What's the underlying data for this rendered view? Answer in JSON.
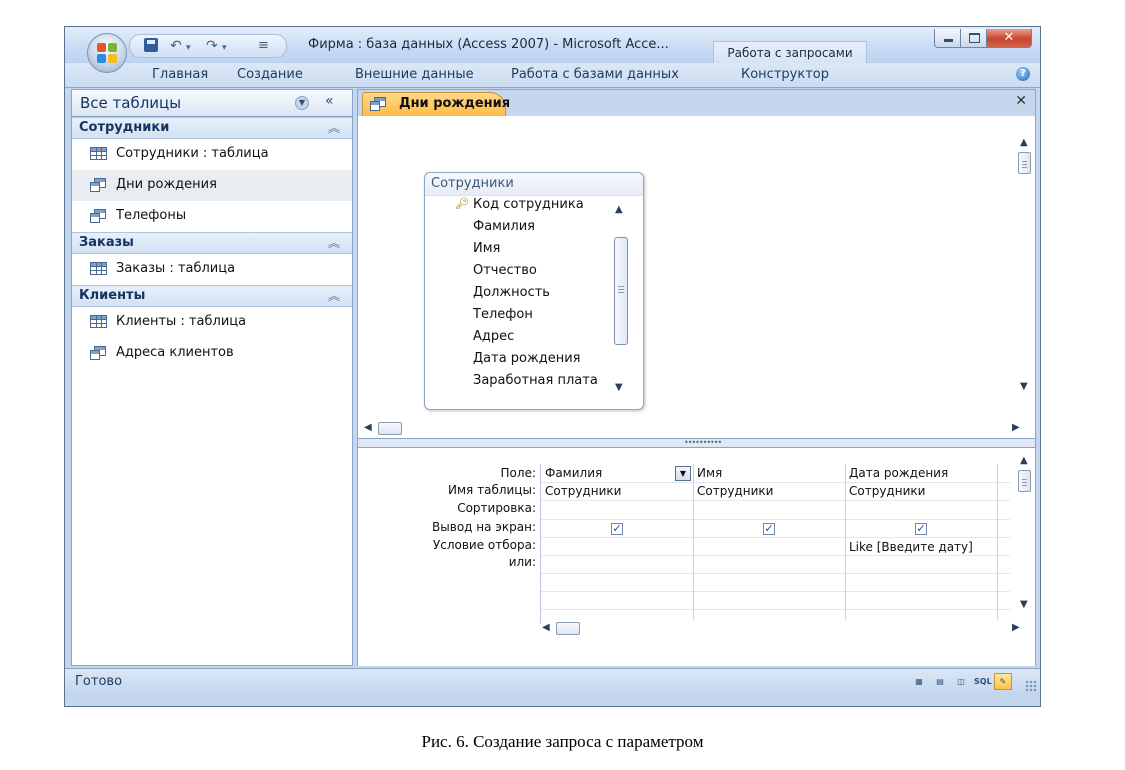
{
  "window": {
    "title": "Фирма : база данных (Access 2007) - Microsoft Acce...",
    "context_tab": "Работа с запросами"
  },
  "ribbon": {
    "tabs": [
      "Главная",
      "Создание",
      "Внешние данные",
      "Работа с базами данных",
      "Конструктор"
    ]
  },
  "nav": {
    "title": "Все таблицы",
    "groups": [
      {
        "title": "Сотрудники",
        "items": [
          {
            "label": "Сотрудники : таблица",
            "icon": "table-icon"
          },
          {
            "label": "Дни рождения",
            "icon": "query-icon",
            "selected": true
          },
          {
            "label": "Телефоны",
            "icon": "query-icon"
          }
        ]
      },
      {
        "title": "Заказы",
        "items": [
          {
            "label": "Заказы : таблица",
            "icon": "table-icon"
          }
        ]
      },
      {
        "title": "Клиенты",
        "items": [
          {
            "label": "Клиенты : таблица",
            "icon": "table-icon"
          },
          {
            "label": "Адреса клиентов",
            "icon": "query-icon"
          }
        ]
      }
    ]
  },
  "document": {
    "tab": "Дни рождения",
    "field_list": {
      "title": "Сотрудники",
      "fields": [
        "Код сотрудника",
        "Фамилия",
        "Имя",
        "Отчество",
        "Должность",
        "Телефон",
        "Адрес",
        "Дата рождения",
        "Заработная плата"
      ]
    },
    "grid": {
      "row_labels": [
        "Поле:",
        "Имя таблицы:",
        "Сортировка:",
        "Вывод на экран:",
        "Условие отбора:",
        "или:"
      ],
      "columns": [
        {
          "field": "Фамилия",
          "table": "Сотрудники",
          "show": true,
          "criteria": ""
        },
        {
          "field": "Имя",
          "table": "Сотрудники",
          "show": true,
          "criteria": ""
        },
        {
          "field": "Дата рождения",
          "table": "Сотрудники",
          "show": true,
          "criteria": "Like [Введите дату]"
        }
      ]
    }
  },
  "status": {
    "text": "Готово",
    "view_buttons": [
      "datasheet",
      "pivot",
      "chart",
      "SQL",
      "design"
    ]
  },
  "caption": "Рис. 6. Создание запроса с параметром"
}
